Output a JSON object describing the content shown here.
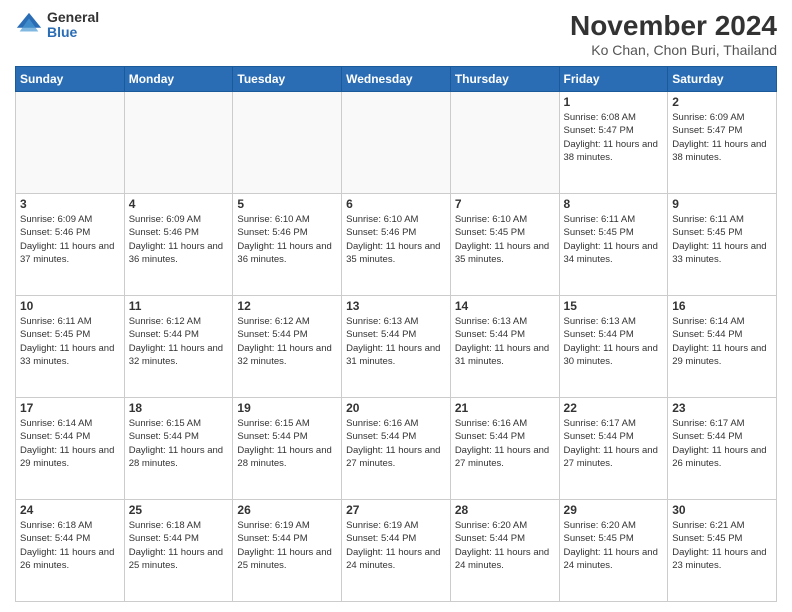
{
  "logo": {
    "general": "General",
    "blue": "Blue"
  },
  "title": "November 2024",
  "subtitle": "Ko Chan, Chon Buri, Thailand",
  "days_of_week": [
    "Sunday",
    "Monday",
    "Tuesday",
    "Wednesday",
    "Thursday",
    "Friday",
    "Saturday"
  ],
  "weeks": [
    [
      {
        "day": "",
        "empty": true
      },
      {
        "day": "",
        "empty": true
      },
      {
        "day": "",
        "empty": true
      },
      {
        "day": "",
        "empty": true
      },
      {
        "day": "",
        "empty": true
      },
      {
        "day": "1",
        "sunrise": "6:08 AM",
        "sunset": "5:47 PM",
        "daylight": "11 hours and 38 minutes."
      },
      {
        "day": "2",
        "sunrise": "6:09 AM",
        "sunset": "5:47 PM",
        "daylight": "11 hours and 38 minutes."
      }
    ],
    [
      {
        "day": "3",
        "sunrise": "6:09 AM",
        "sunset": "5:46 PM",
        "daylight": "11 hours and 37 minutes."
      },
      {
        "day": "4",
        "sunrise": "6:09 AM",
        "sunset": "5:46 PM",
        "daylight": "11 hours and 36 minutes."
      },
      {
        "day": "5",
        "sunrise": "6:10 AM",
        "sunset": "5:46 PM",
        "daylight": "11 hours and 36 minutes."
      },
      {
        "day": "6",
        "sunrise": "6:10 AM",
        "sunset": "5:46 PM",
        "daylight": "11 hours and 35 minutes."
      },
      {
        "day": "7",
        "sunrise": "6:10 AM",
        "sunset": "5:45 PM",
        "daylight": "11 hours and 35 minutes."
      },
      {
        "day": "8",
        "sunrise": "6:11 AM",
        "sunset": "5:45 PM",
        "daylight": "11 hours and 34 minutes."
      },
      {
        "day": "9",
        "sunrise": "6:11 AM",
        "sunset": "5:45 PM",
        "daylight": "11 hours and 33 minutes."
      }
    ],
    [
      {
        "day": "10",
        "sunrise": "6:11 AM",
        "sunset": "5:45 PM",
        "daylight": "11 hours and 33 minutes."
      },
      {
        "day": "11",
        "sunrise": "6:12 AM",
        "sunset": "5:44 PM",
        "daylight": "11 hours and 32 minutes."
      },
      {
        "day": "12",
        "sunrise": "6:12 AM",
        "sunset": "5:44 PM",
        "daylight": "11 hours and 32 minutes."
      },
      {
        "day": "13",
        "sunrise": "6:13 AM",
        "sunset": "5:44 PM",
        "daylight": "11 hours and 31 minutes."
      },
      {
        "day": "14",
        "sunrise": "6:13 AM",
        "sunset": "5:44 PM",
        "daylight": "11 hours and 31 minutes."
      },
      {
        "day": "15",
        "sunrise": "6:13 AM",
        "sunset": "5:44 PM",
        "daylight": "11 hours and 30 minutes."
      },
      {
        "day": "16",
        "sunrise": "6:14 AM",
        "sunset": "5:44 PM",
        "daylight": "11 hours and 29 minutes."
      }
    ],
    [
      {
        "day": "17",
        "sunrise": "6:14 AM",
        "sunset": "5:44 PM",
        "daylight": "11 hours and 29 minutes."
      },
      {
        "day": "18",
        "sunrise": "6:15 AM",
        "sunset": "5:44 PM",
        "daylight": "11 hours and 28 minutes."
      },
      {
        "day": "19",
        "sunrise": "6:15 AM",
        "sunset": "5:44 PM",
        "daylight": "11 hours and 28 minutes."
      },
      {
        "day": "20",
        "sunrise": "6:16 AM",
        "sunset": "5:44 PM",
        "daylight": "11 hours and 27 minutes."
      },
      {
        "day": "21",
        "sunrise": "6:16 AM",
        "sunset": "5:44 PM",
        "daylight": "11 hours and 27 minutes."
      },
      {
        "day": "22",
        "sunrise": "6:17 AM",
        "sunset": "5:44 PM",
        "daylight": "11 hours and 27 minutes."
      },
      {
        "day": "23",
        "sunrise": "6:17 AM",
        "sunset": "5:44 PM",
        "daylight": "11 hours and 26 minutes."
      }
    ],
    [
      {
        "day": "24",
        "sunrise": "6:18 AM",
        "sunset": "5:44 PM",
        "daylight": "11 hours and 26 minutes."
      },
      {
        "day": "25",
        "sunrise": "6:18 AM",
        "sunset": "5:44 PM",
        "daylight": "11 hours and 25 minutes."
      },
      {
        "day": "26",
        "sunrise": "6:19 AM",
        "sunset": "5:44 PM",
        "daylight": "11 hours and 25 minutes."
      },
      {
        "day": "27",
        "sunrise": "6:19 AM",
        "sunset": "5:44 PM",
        "daylight": "11 hours and 24 minutes."
      },
      {
        "day": "28",
        "sunrise": "6:20 AM",
        "sunset": "5:44 PM",
        "daylight": "11 hours and 24 minutes."
      },
      {
        "day": "29",
        "sunrise": "6:20 AM",
        "sunset": "5:45 PM",
        "daylight": "11 hours and 24 minutes."
      },
      {
        "day": "30",
        "sunrise": "6:21 AM",
        "sunset": "5:45 PM",
        "daylight": "11 hours and 23 minutes."
      }
    ]
  ]
}
